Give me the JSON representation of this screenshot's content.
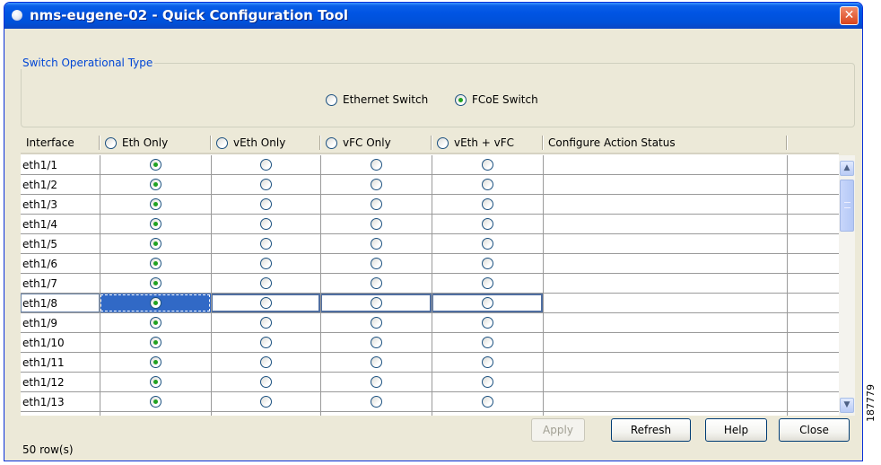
{
  "window": {
    "title": "nms-eugene-02 - Quick Configuration Tool",
    "close_label": "✕"
  },
  "switch_type": {
    "legend": "Switch Operational Type",
    "options": [
      {
        "label": "Ethernet Switch",
        "checked": false
      },
      {
        "label": "FCoE Switch",
        "checked": true
      }
    ]
  },
  "table": {
    "columns": [
      "Interface",
      "Eth Only",
      "vEth Only",
      "vFC Only",
      "vEth + vFC",
      "Configure Action Status"
    ],
    "rows": [
      {
        "interface": "eth1/1",
        "selection": "Eth Only"
      },
      {
        "interface": "eth1/2",
        "selection": "Eth Only"
      },
      {
        "interface": "eth1/3",
        "selection": "Eth Only"
      },
      {
        "interface": "eth1/4",
        "selection": "Eth Only"
      },
      {
        "interface": "eth1/5",
        "selection": "Eth Only"
      },
      {
        "interface": "eth1/6",
        "selection": "Eth Only"
      },
      {
        "interface": "eth1/7",
        "selection": "Eth Only"
      },
      {
        "interface": "eth1/8",
        "selection": "Eth Only",
        "selected_row": true
      },
      {
        "interface": "eth1/9",
        "selection": "Eth Only"
      },
      {
        "interface": "eth1/10",
        "selection": "Eth Only"
      },
      {
        "interface": "eth1/11",
        "selection": "Eth Only"
      },
      {
        "interface": "eth1/12",
        "selection": "Eth Only"
      },
      {
        "interface": "eth1/13",
        "selection": "Eth Only"
      }
    ]
  },
  "buttons": {
    "apply": "Apply",
    "refresh": "Refresh",
    "help": "Help",
    "close": "Close"
  },
  "status": {
    "row_count": "50 row(s)"
  },
  "figure_id": "187779",
  "colors": {
    "title_bar": "#0054e3",
    "selected_cell": "#3169c6",
    "window_bg": "#ece9d8",
    "radio_dot": "#21a121"
  }
}
